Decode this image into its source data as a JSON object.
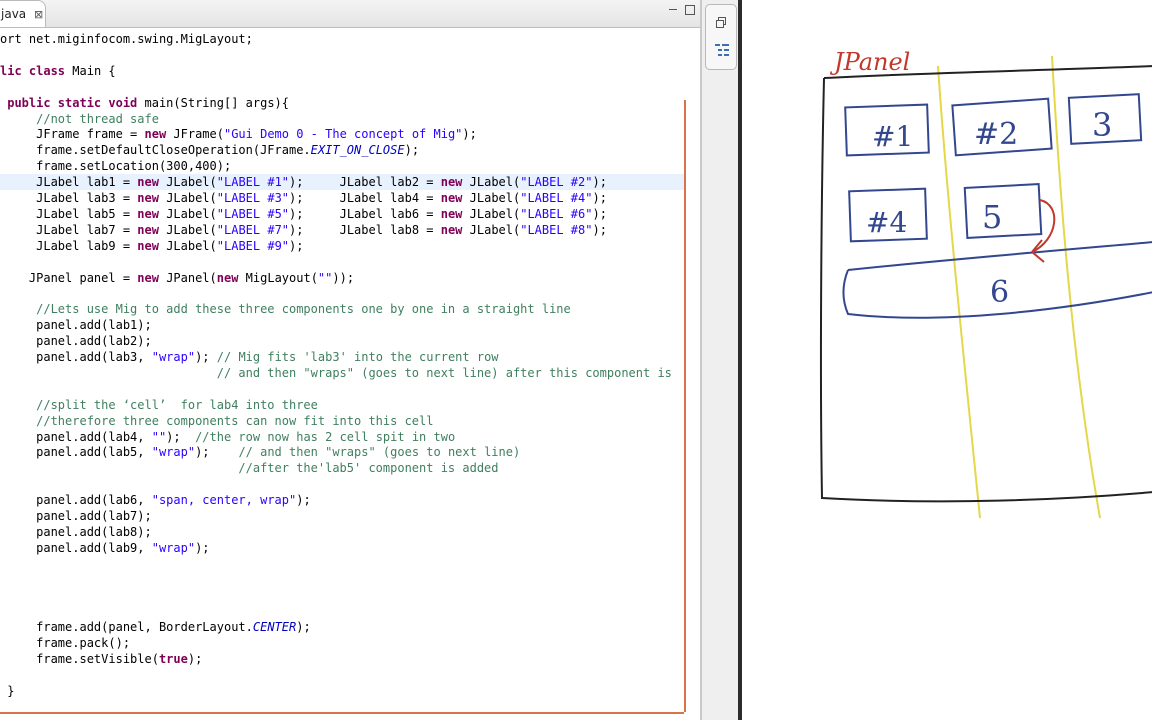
{
  "editor": {
    "tab_label": "java",
    "tab_close_glyph": "⊠",
    "code_lines": [
      {
        "segs": [
          {
            "t": "ort net.miginfocom.swing.MigLayout;",
            "c": ""
          }
        ]
      },
      {
        "segs": []
      },
      {
        "segs": [
          {
            "t": "lic ",
            "c": "kw"
          },
          {
            "t": "class ",
            "c": "kw"
          },
          {
            "t": "Main {",
            "c": ""
          }
        ]
      },
      {
        "segs": []
      },
      {
        "segs": [
          {
            "t": " public static void ",
            "c": "kw"
          },
          {
            "t": "main(String[] args){",
            "c": ""
          }
        ]
      },
      {
        "segs": [
          {
            "t": "     //not thread safe",
            "c": "cmt"
          }
        ]
      },
      {
        "segs": [
          {
            "t": "     JFrame frame = ",
            "c": ""
          },
          {
            "t": "new ",
            "c": "kw"
          },
          {
            "t": "JFrame(",
            "c": ""
          },
          {
            "t": "\"Gui Demo 0 - The concept of Mig\"",
            "c": "str"
          },
          {
            "t": ");",
            "c": ""
          }
        ]
      },
      {
        "segs": [
          {
            "t": "     frame.setDefaultCloseOperation(JFrame.",
            "c": ""
          },
          {
            "t": "EXIT_ON_CLOSE",
            "c": "ital"
          },
          {
            "t": ");",
            "c": ""
          }
        ]
      },
      {
        "segs": [
          {
            "t": "     frame.setLocation(300,400);",
            "c": ""
          }
        ]
      },
      {
        "segs": [
          {
            "t": "     JLabel lab1 = ",
            "c": ""
          },
          {
            "t": "new ",
            "c": "kw"
          },
          {
            "t": "JLabel(",
            "c": ""
          },
          {
            "t": "\"LABEL #1\"",
            "c": "str"
          },
          {
            "t": ");     JLabel lab2 = ",
            "c": ""
          },
          {
            "t": "new ",
            "c": "kw"
          },
          {
            "t": "JLabel(",
            "c": ""
          },
          {
            "t": "\"LABEL #2\"",
            "c": "str"
          },
          {
            "t": ");",
            "c": ""
          }
        ],
        "hl": true
      },
      {
        "segs": [
          {
            "t": "     JLabel lab3 = ",
            "c": ""
          },
          {
            "t": "new ",
            "c": "kw"
          },
          {
            "t": "JLabel(",
            "c": ""
          },
          {
            "t": "\"LABEL #3\"",
            "c": "str"
          },
          {
            "t": ");     JLabel lab4 = ",
            "c": ""
          },
          {
            "t": "new ",
            "c": "kw"
          },
          {
            "t": "JLabel(",
            "c": ""
          },
          {
            "t": "\"LABEL #4\"",
            "c": "str"
          },
          {
            "t": ");",
            "c": ""
          }
        ]
      },
      {
        "segs": [
          {
            "t": "     JLabel lab5 = ",
            "c": ""
          },
          {
            "t": "new ",
            "c": "kw"
          },
          {
            "t": "JLabel(",
            "c": ""
          },
          {
            "t": "\"LABEL #5\"",
            "c": "str"
          },
          {
            "t": ");     JLabel lab6 = ",
            "c": ""
          },
          {
            "t": "new ",
            "c": "kw"
          },
          {
            "t": "JLabel(",
            "c": ""
          },
          {
            "t": "\"LABEL #6\"",
            "c": "str"
          },
          {
            "t": ");",
            "c": ""
          }
        ]
      },
      {
        "segs": [
          {
            "t": "     JLabel lab7 = ",
            "c": ""
          },
          {
            "t": "new ",
            "c": "kw"
          },
          {
            "t": "JLabel(",
            "c": ""
          },
          {
            "t": "\"LABEL #7\"",
            "c": "str"
          },
          {
            "t": ");     JLabel lab8 = ",
            "c": ""
          },
          {
            "t": "new ",
            "c": "kw"
          },
          {
            "t": "JLabel(",
            "c": ""
          },
          {
            "t": "\"LABEL #8\"",
            "c": "str"
          },
          {
            "t": ");",
            "c": ""
          }
        ]
      },
      {
        "segs": [
          {
            "t": "     JLabel lab9 = ",
            "c": ""
          },
          {
            "t": "new ",
            "c": "kw"
          },
          {
            "t": "JLabel(",
            "c": ""
          },
          {
            "t": "\"LABEL #9\"",
            "c": "str"
          },
          {
            "t": ");",
            "c": ""
          }
        ]
      },
      {
        "segs": []
      },
      {
        "segs": [
          {
            "t": "    JPanel panel = ",
            "c": ""
          },
          {
            "t": "new ",
            "c": "kw"
          },
          {
            "t": "JPanel(",
            "c": ""
          },
          {
            "t": "new ",
            "c": "kw"
          },
          {
            "t": "MigLayout(",
            "c": ""
          },
          {
            "t": "\"\"",
            "c": "str"
          },
          {
            "t": "));",
            "c": ""
          }
        ]
      },
      {
        "segs": []
      },
      {
        "segs": [
          {
            "t": "     //Lets use Mig to add these three components one by one in a straight line",
            "c": "cmt"
          }
        ]
      },
      {
        "segs": [
          {
            "t": "     panel.add(lab1);",
            "c": ""
          }
        ]
      },
      {
        "segs": [
          {
            "t": "     panel.add(lab2);",
            "c": ""
          }
        ]
      },
      {
        "segs": [
          {
            "t": "     panel.add(lab3, ",
            "c": ""
          },
          {
            "t": "\"wrap\"",
            "c": "str"
          },
          {
            "t": "); ",
            "c": ""
          },
          {
            "t": "// Mig fits 'lab3' into the current row",
            "c": "cmt"
          }
        ]
      },
      {
        "segs": [
          {
            "t": "                              // and then \"wraps\" (goes to next line) after this component is",
            "c": "cmt"
          }
        ]
      },
      {
        "segs": []
      },
      {
        "segs": [
          {
            "t": "     //split the ‘cell’  for lab4 into three",
            "c": "cmt"
          }
        ]
      },
      {
        "segs": [
          {
            "t": "     //therefore three components can now fit into this cell",
            "c": "cmt"
          }
        ]
      },
      {
        "segs": [
          {
            "t": "     panel.add(lab4, ",
            "c": ""
          },
          {
            "t": "\"\"",
            "c": "str"
          },
          {
            "t": ");  ",
            "c": ""
          },
          {
            "t": "//the row now has 2 cell spit in two",
            "c": "cmt"
          }
        ]
      },
      {
        "segs": [
          {
            "t": "     panel.add(lab5, ",
            "c": ""
          },
          {
            "t": "\"wrap\"",
            "c": "str"
          },
          {
            "t": ");    ",
            "c": ""
          },
          {
            "t": "// and then \"wraps\" (goes to next line)",
            "c": "cmt"
          }
        ]
      },
      {
        "segs": [
          {
            "t": "                                 //after the'lab5' component is added",
            "c": "cmt"
          }
        ]
      },
      {
        "segs": []
      },
      {
        "segs": [
          {
            "t": "     panel.add(lab6, ",
            "c": ""
          },
          {
            "t": "\"span, center, wrap\"",
            "c": "str"
          },
          {
            "t": ");",
            "c": ""
          }
        ]
      },
      {
        "segs": [
          {
            "t": "     panel.add(lab7);",
            "c": ""
          }
        ]
      },
      {
        "segs": [
          {
            "t": "     panel.add(lab8);",
            "c": ""
          }
        ]
      },
      {
        "segs": [
          {
            "t": "     panel.add(lab9, ",
            "c": ""
          },
          {
            "t": "\"wrap\"",
            "c": "str"
          },
          {
            "t": ");",
            "c": ""
          }
        ]
      },
      {
        "segs": []
      },
      {
        "segs": []
      },
      {
        "segs": []
      },
      {
        "segs": []
      },
      {
        "segs": [
          {
            "t": "     frame.add(panel, BorderLayout.",
            "c": ""
          },
          {
            "t": "CENTER",
            "c": "ital"
          },
          {
            "t": ");",
            "c": ""
          }
        ]
      },
      {
        "segs": [
          {
            "t": "     frame.pack();",
            "c": ""
          }
        ]
      },
      {
        "segs": [
          {
            "t": "     frame.setVisible(",
            "c": ""
          },
          {
            "t": "true",
            "c": "kw"
          },
          {
            "t": ");",
            "c": ""
          }
        ]
      },
      {
        "segs": []
      },
      {
        "segs": [
          {
            "t": " }",
            "c": ""
          }
        ]
      }
    ]
  },
  "whiteboard": {
    "title": "JPanel",
    "cells": [
      "#1",
      "#2",
      "3",
      "#4",
      "5",
      "6"
    ],
    "ink_color": "#33478f",
    "frame_color": "#222222",
    "guide_color": "#e4d84a",
    "arrow_color": "#c0392b"
  }
}
